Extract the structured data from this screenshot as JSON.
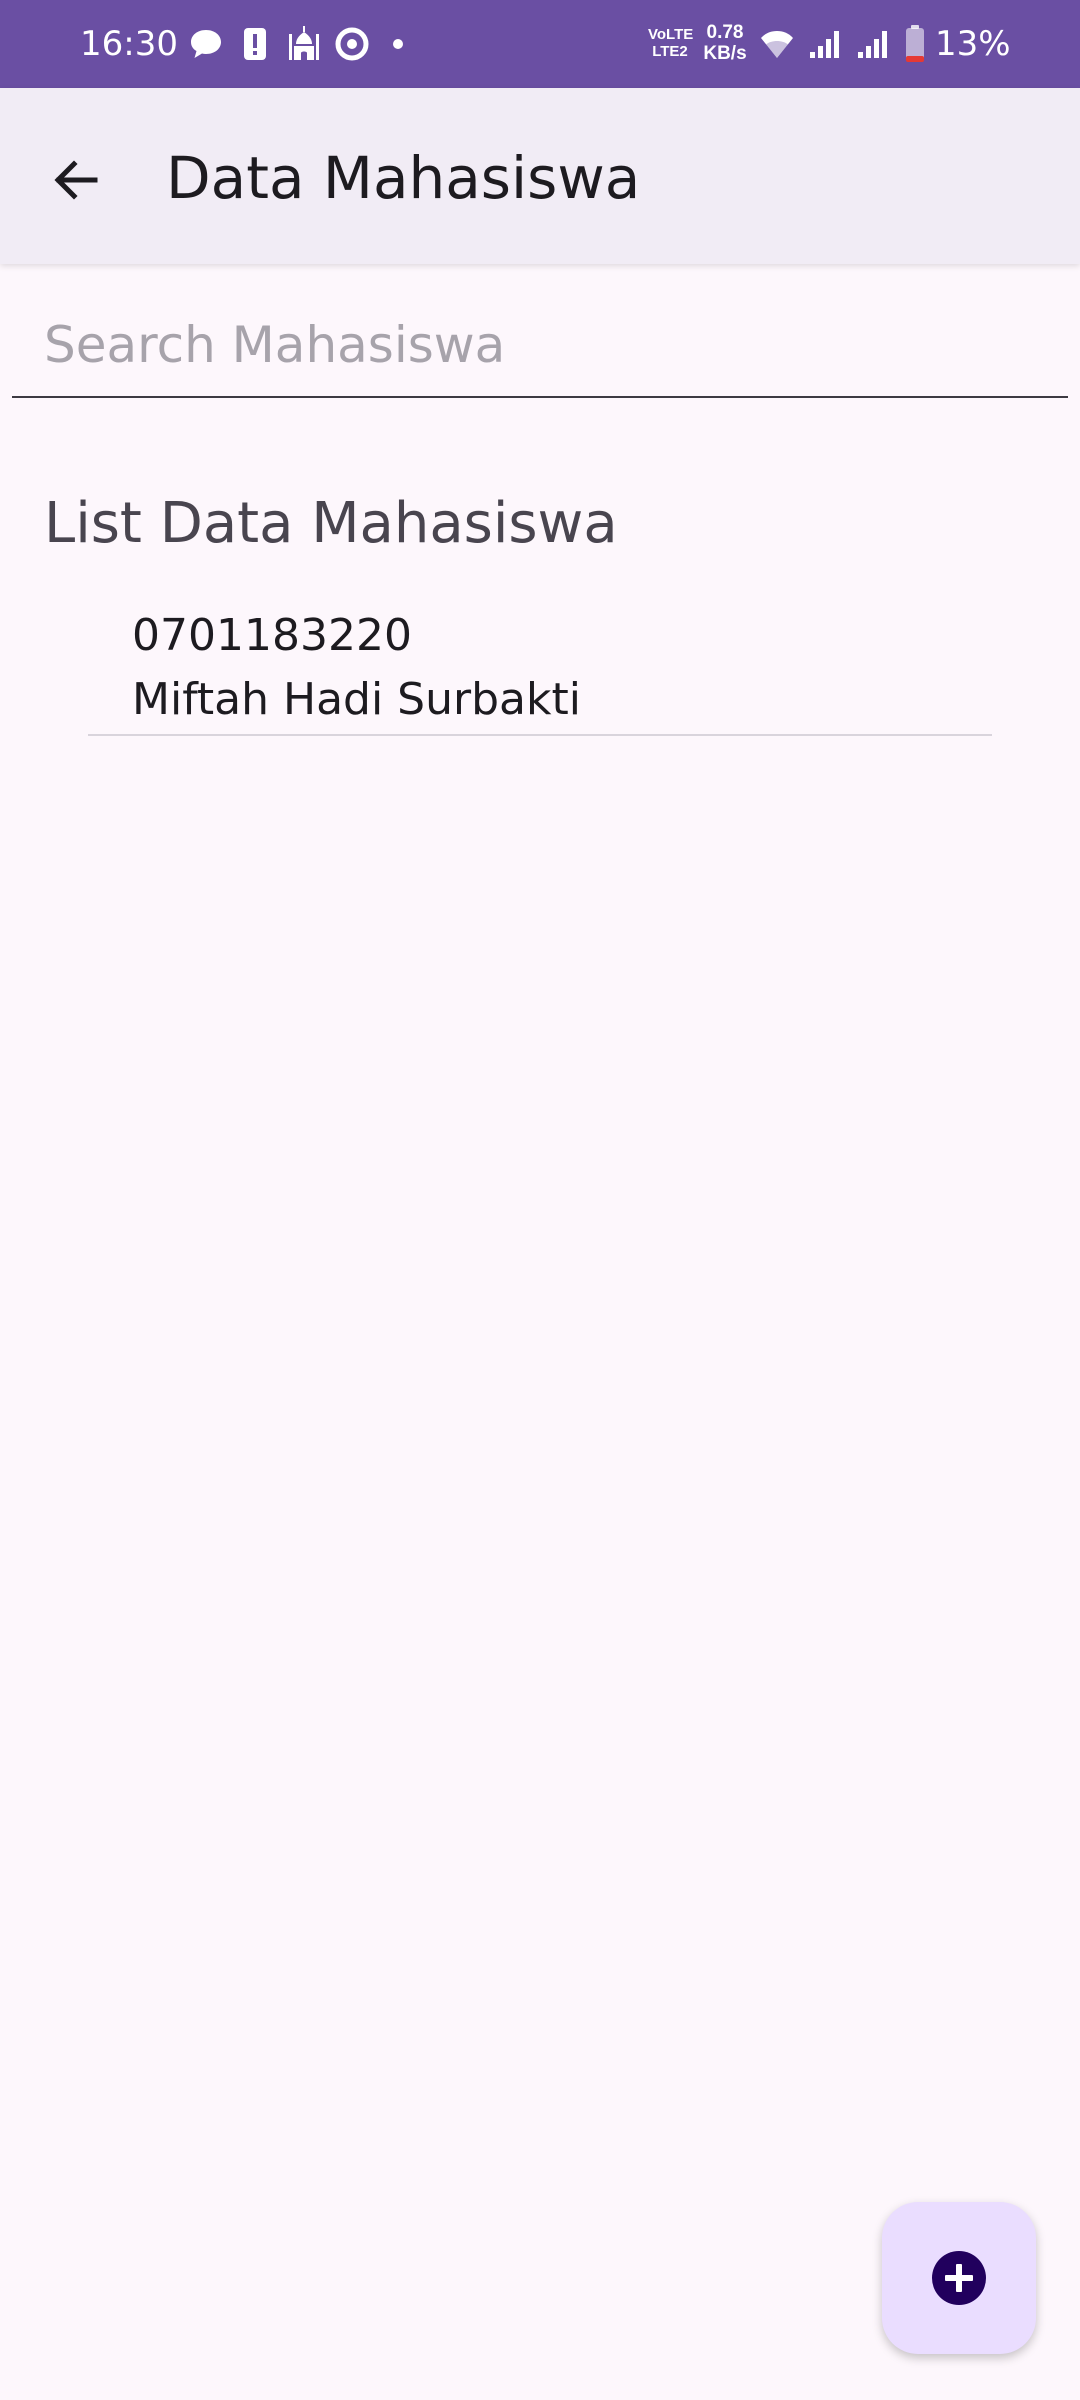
{
  "status_bar": {
    "time": "16:30",
    "network_speed_value": "0.78",
    "network_speed_unit": "KB/s",
    "network_type_top": "VoLTE",
    "network_type_bottom": "LTE2",
    "battery_percent": "13%",
    "icons": [
      "chat-icon",
      "alert-icon",
      "mosque-icon",
      "sync-icon",
      "dot-icon",
      "wifi-icon",
      "signal-icon",
      "signal-icon",
      "battery-icon"
    ],
    "colors": {
      "background": "#6a4fa3",
      "battery_low": "#e53935"
    }
  },
  "app_bar": {
    "title": "Data Mahasiswa",
    "back_icon": "arrow-back-icon"
  },
  "search": {
    "placeholder": "Search Mahasiswa",
    "value": ""
  },
  "section": {
    "title": "List Data Mahasiswa"
  },
  "students": [
    {
      "nim": "0701183220",
      "name": "Miftah Hadi Surbakti"
    }
  ],
  "fab": {
    "icon": "add-circle-icon",
    "colors": {
      "background": "#eaddff",
      "icon": "#21005d"
    }
  },
  "theme": {
    "background": "#fdf7fc",
    "app_bar": "#f1ecf5"
  }
}
